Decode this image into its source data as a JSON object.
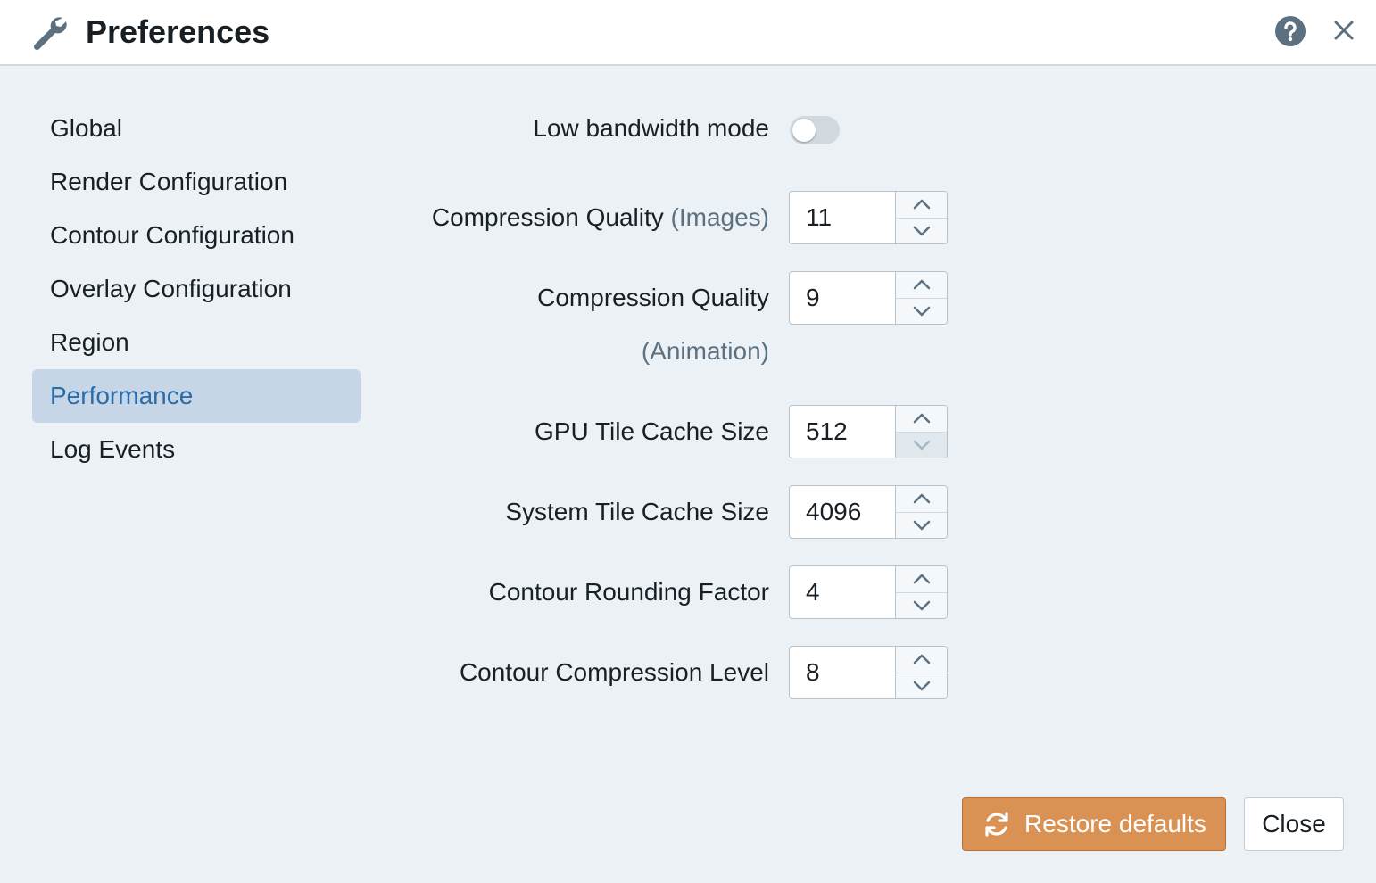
{
  "header": {
    "title": "Preferences",
    "icons": [
      "wrench-icon",
      "help-icon",
      "close-icon"
    ]
  },
  "sidebar": {
    "items": [
      {
        "label": "Global",
        "active": false
      },
      {
        "label": "Render Configuration",
        "active": false
      },
      {
        "label": "Contour Configuration",
        "active": false
      },
      {
        "label": "Overlay Configuration",
        "active": false
      },
      {
        "label": "Region",
        "active": false
      },
      {
        "label": "Performance",
        "active": true
      },
      {
        "label": "Log Events",
        "active": false
      }
    ]
  },
  "performance": {
    "low_bandwidth": {
      "label": "Low bandwidth mode",
      "enabled": false
    },
    "compression_images": {
      "label": "Compression Quality",
      "label_muted": "(Images)",
      "value": "11"
    },
    "compression_animation": {
      "label": "Compression Quality",
      "label_muted": "(Animation)",
      "value": "9"
    },
    "gpu_tile_cache": {
      "label": "GPU Tile Cache Size",
      "value": "512",
      "decrement_disabled": true
    },
    "system_tile_cache": {
      "label": "System Tile Cache Size",
      "value": "4096"
    },
    "contour_rounding": {
      "label": "Contour Rounding Factor",
      "value": "4"
    },
    "contour_compression": {
      "label": "Contour Compression Level",
      "value": "8"
    }
  },
  "footer": {
    "restore_label": "Restore defaults",
    "close_label": "Close"
  },
  "colors": {
    "accent": "#2b6ca8",
    "active_bg": "#c6d6e7",
    "restore_bg": "#d99254",
    "panel_bg": "#ebf1f5"
  }
}
